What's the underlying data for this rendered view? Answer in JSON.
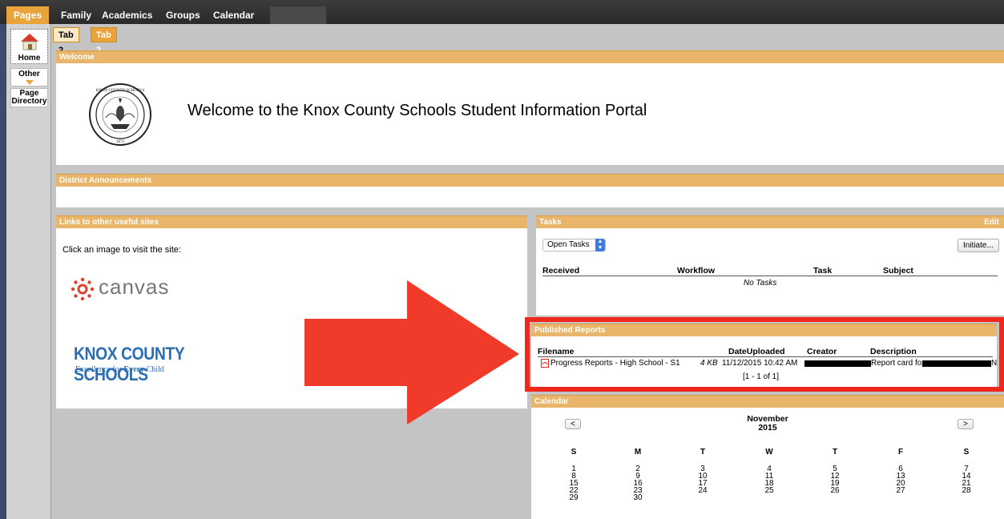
{
  "topnav": {
    "pages_label": "Pages",
    "links": [
      "Family",
      "Academics",
      "Groups",
      "Calendar"
    ]
  },
  "sidebar": {
    "home_label": "Home",
    "other_label": "Other",
    "page_directory_label": "Page Directory"
  },
  "tabs": [
    "Tab 2",
    "Tab 2"
  ],
  "welcome": {
    "header": "Welcome",
    "message": "Welcome to the Knox County Schools Student Information Portal",
    "seal_text_top": "KNOX COUNTY SCHOOLS",
    "seal_year": "1873"
  },
  "announcements": {
    "header": "District Announcements"
  },
  "links_panel": {
    "header": "Links to other useful sites",
    "intro": "Click an image to visit the site:",
    "canvas_label": "canvas",
    "kcs_label": "KNOX COUNTY SCHOOLS",
    "kcs_tagline_pre": "Excellence for ",
    "kcs_tagline_every": "Every",
    "kcs_tagline_post": " Child"
  },
  "tasks": {
    "header": "Tasks",
    "edit_label": "Edit",
    "select_value": "Open Tasks",
    "initiate_label": "Initiate...",
    "columns": [
      "Received",
      "Workflow",
      "Task",
      "Subject"
    ],
    "empty_text": "No Tasks"
  },
  "reports": {
    "header": "Published Reports",
    "columns": [
      "Filename",
      "DateUploaded",
      "Creator",
      "Description"
    ],
    "rows": [
      {
        "filename": "Progress Reports - High School - S1",
        "size": "4 KB",
        "date": "11/12/2015 10:42 AM",
        "description_pre": "Report card for",
        "description_post": "N"
      }
    ],
    "pagination": "[1 - 1 of 1]"
  },
  "calendar": {
    "header": "Calendar",
    "prev_label": "<",
    "next_label": ">",
    "month": "November",
    "year": "2015",
    "days": [
      "S",
      "M",
      "T",
      "W",
      "T",
      "F",
      "S"
    ],
    "weeks": [
      [
        "1",
        "2",
        "3",
        "4",
        "5",
        "6",
        "7"
      ],
      [
        "8",
        "9",
        "10",
        "11",
        "12",
        "13",
        "14"
      ],
      [
        "15",
        "16",
        "17",
        "18",
        "19",
        "20",
        "21"
      ],
      [
        "22",
        "23",
        "24",
        "25",
        "26",
        "27",
        "28"
      ],
      [
        "29",
        "30",
        "",
        "",
        "",
        "",
        ""
      ]
    ]
  },
  "colors": {
    "accent": "#e8a33a",
    "panel_header": "#e8b56a",
    "arrow_red": "#f03a2a",
    "highlight_border": "#f2271c",
    "sidebar_strip": "#3d4a6e"
  }
}
